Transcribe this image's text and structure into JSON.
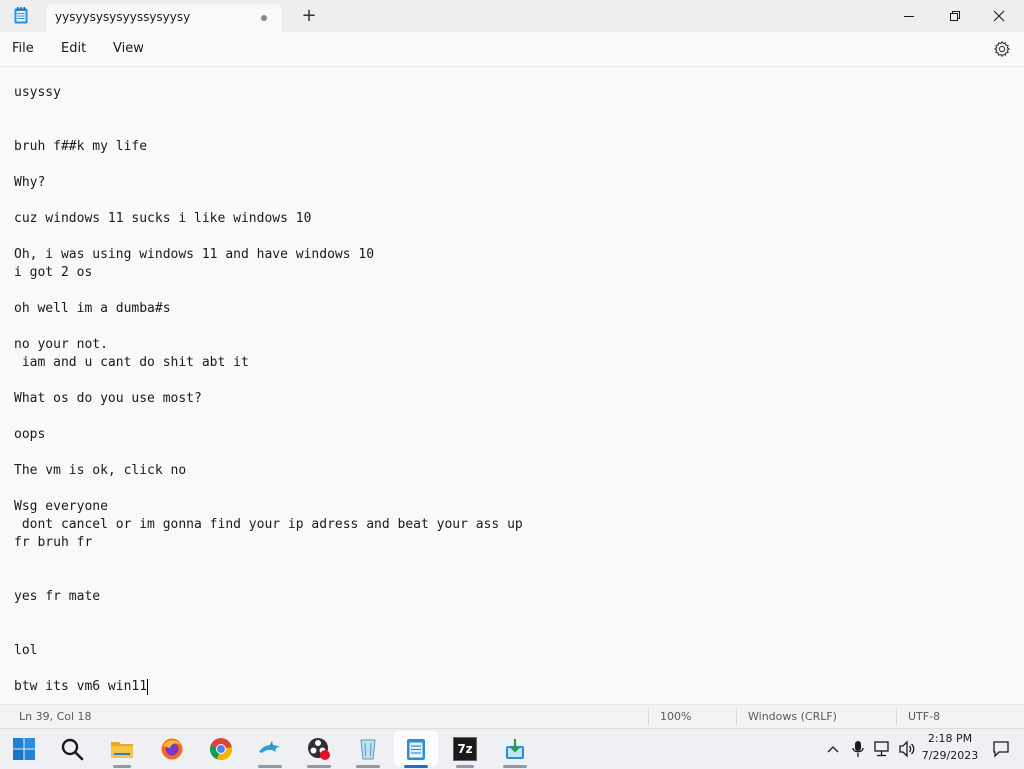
{
  "window": {
    "tab_title": "yysyysysysyyssysyysy",
    "new_tab_label": "+"
  },
  "menu": {
    "file": "File",
    "edit": "Edit",
    "view": "View"
  },
  "document": {
    "lines": [
      "usyssy",
      "",
      "",
      "bruh f##k my life",
      "",
      "Why?",
      "",
      "cuz windows 11 sucks i like windows 10",
      "",
      "Oh, i was using windows 11 and have windows 10",
      "i got 2 os",
      "",
      "oh well im a dumba#s",
      "",
      "no your not.",
      " iam and u cant do shit abt it",
      "",
      "What os do you use most?",
      "",
      "oops",
      "",
      "The vm is ok, click no",
      "",
      "Wsg everyone",
      " dont cancel or im gonna find your ip adress and beat your ass up",
      "fr bruh fr",
      "",
      "",
      "yes fr mate",
      "",
      "",
      "lol",
      "",
      "btw its vm6 win11"
    ]
  },
  "status": {
    "position": "Ln 39, Col 18",
    "zoom": "100%",
    "line_ending": "Windows (CRLF)",
    "encoding": "UTF-8"
  },
  "taskbar": {
    "apps": [
      "start-icon",
      "search-icon",
      "file-explorer-icon",
      "firefox-icon",
      "chrome-icon",
      "dolphin-icon",
      "obs-icon",
      "recycle-bin-icon",
      "notepad-icon",
      "7zip-icon",
      "app-installer-icon"
    ],
    "sevenzip_label": "7z",
    "time": "2:18 PM",
    "date": "7/29/2023"
  }
}
